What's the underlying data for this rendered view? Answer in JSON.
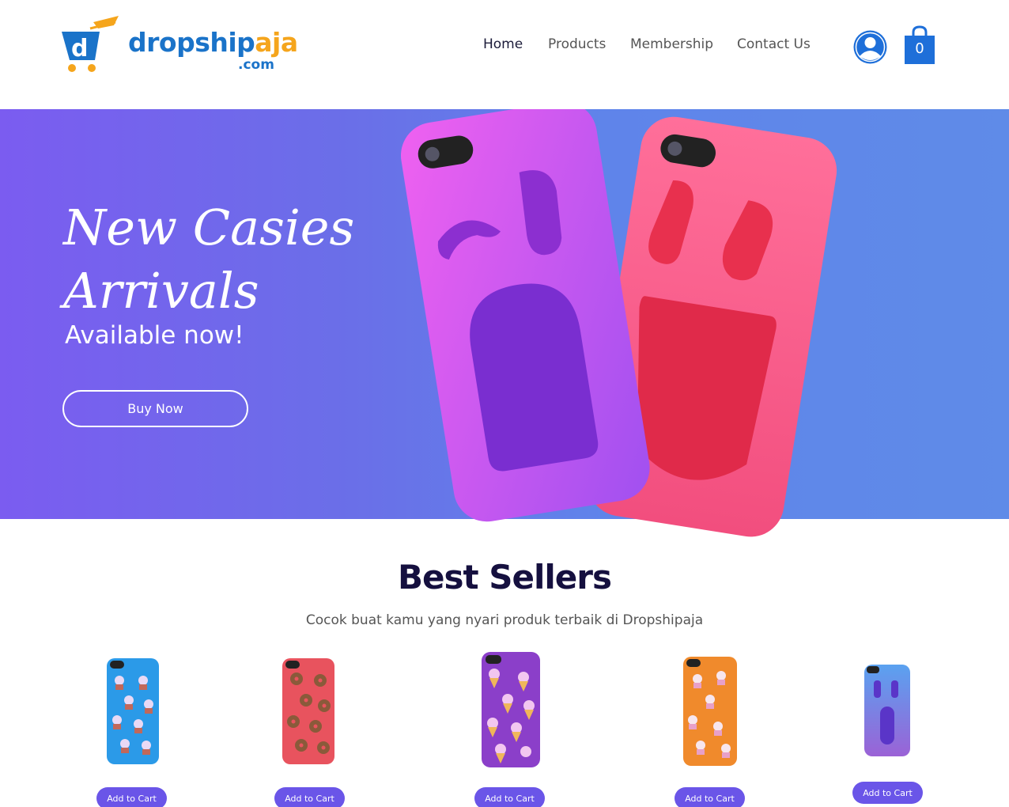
{
  "brand": {
    "name_main": "dropship",
    "name_accent": "aja",
    "domain_suffix": ".com"
  },
  "nav": {
    "items": [
      {
        "label": "Home",
        "active": true
      },
      {
        "label": "Products"
      },
      {
        "label": "Membership"
      },
      {
        "label": "Contact Us"
      }
    ]
  },
  "header": {
    "account_icon": "user-circle-icon",
    "cart_icon": "shopping-bag-icon",
    "cart_count": "0"
  },
  "hero": {
    "title_line1": "New Casies",
    "title_line2": "Arrivals",
    "subtitle": "Available now!",
    "button_label": "Buy Now"
  },
  "best_sellers": {
    "title": "Best Sellers",
    "subtitle": "Cocok buat kamu yang nyari produk terbaik di Dropshipaja",
    "products": [
      {
        "pattern": "cupcakes",
        "color": "#2b9ae8",
        "button_label": "Add to Cart"
      },
      {
        "pattern": "donuts",
        "color": "#e8535e",
        "button_label": "Add to Cart"
      },
      {
        "pattern": "ice-cream",
        "color": "#8b3fc9",
        "button_label": "Add to Cart"
      },
      {
        "pattern": "cupcakes",
        "color": "#f08a2c",
        "button_label": "Add to Cart"
      },
      {
        "pattern": "surprised-face",
        "color": "#7c6ee0",
        "button_label": "Add to Cart"
      }
    ]
  },
  "colors": {
    "accent": "#6a55e8",
    "brand_blue": "#1a73c9",
    "brand_orange": "#f5a51c",
    "title_dark": "#15103f"
  }
}
